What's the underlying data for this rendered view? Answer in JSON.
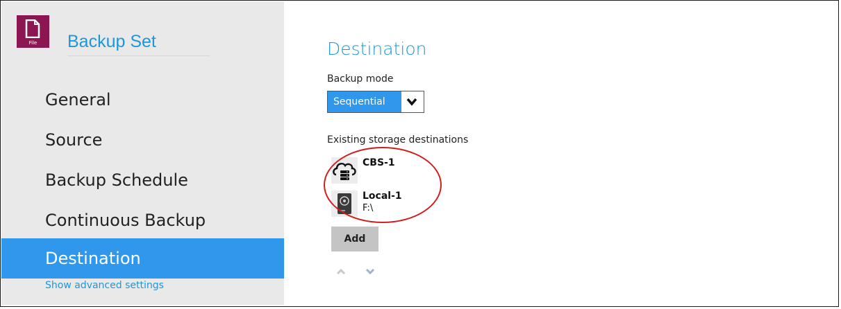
{
  "sidebar": {
    "icon_name": "file-icon",
    "icon_label": "File",
    "title": "Backup Set",
    "items": [
      {
        "label": "General",
        "active": false
      },
      {
        "label": "Source",
        "active": false
      },
      {
        "label": "Backup Schedule",
        "active": false
      },
      {
        "label": "Continuous Backup",
        "active": false
      },
      {
        "label": "Destination",
        "active": true
      }
    ],
    "advanced_link": "Show advanced settings"
  },
  "main": {
    "title": "Destination",
    "backup_mode_label": "Backup mode",
    "backup_mode_value": "Sequential",
    "storage_label": "Existing storage destinations",
    "destinations": [
      {
        "name": "CBS-1",
        "path": "",
        "icon": "cloud-server-icon"
      },
      {
        "name": "Local-1",
        "path": "F:\\",
        "icon": "local-drive-icon"
      }
    ],
    "add_label": "Add"
  },
  "colors": {
    "accent": "#2f97ec",
    "title_blue": "#1e97d9",
    "file_icon_bg": "#8c1652",
    "sidebar_bg": "#e9e9e9",
    "highlight": "#d21c1c"
  }
}
